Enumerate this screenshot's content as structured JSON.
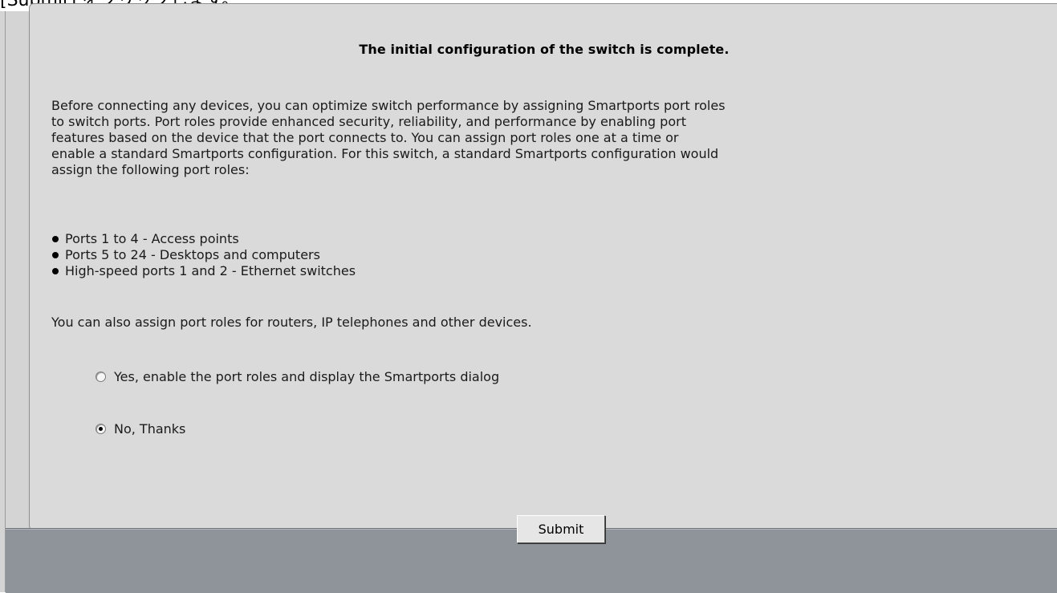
{
  "caption": {
    "text": "[Submit] をクリックします。"
  },
  "panel": {
    "title": "The initial configuration of the switch is complete.",
    "body_lines": [
      "Before connecting any devices, you can optimize switch performance by assigning Smartports port roles",
      "to switch ports. Port roles provide enhanced security, reliability, and performance by enabling port",
      "features based on the device that the port connects to. You can assign port roles one at a time or",
      "enable a standard Smartports configuration. For this switch, a standard Smartports configuration would",
      "assign the following port roles:"
    ],
    "bullets": [
      "Ports 1 to 4 - Access points",
      "Ports 5 to 24 - Desktops and computers",
      "High-speed ports 1 and 2 - Ethernet switches"
    ],
    "also_text": "You can also assign port roles for routers, IP telephones and other devices.",
    "options": {
      "yes_label": "Yes, enable the port roles and display the Smartports dialog",
      "no_label": "No, Thanks",
      "selected": "no"
    }
  },
  "footer": {
    "submit_label": "Submit"
  }
}
